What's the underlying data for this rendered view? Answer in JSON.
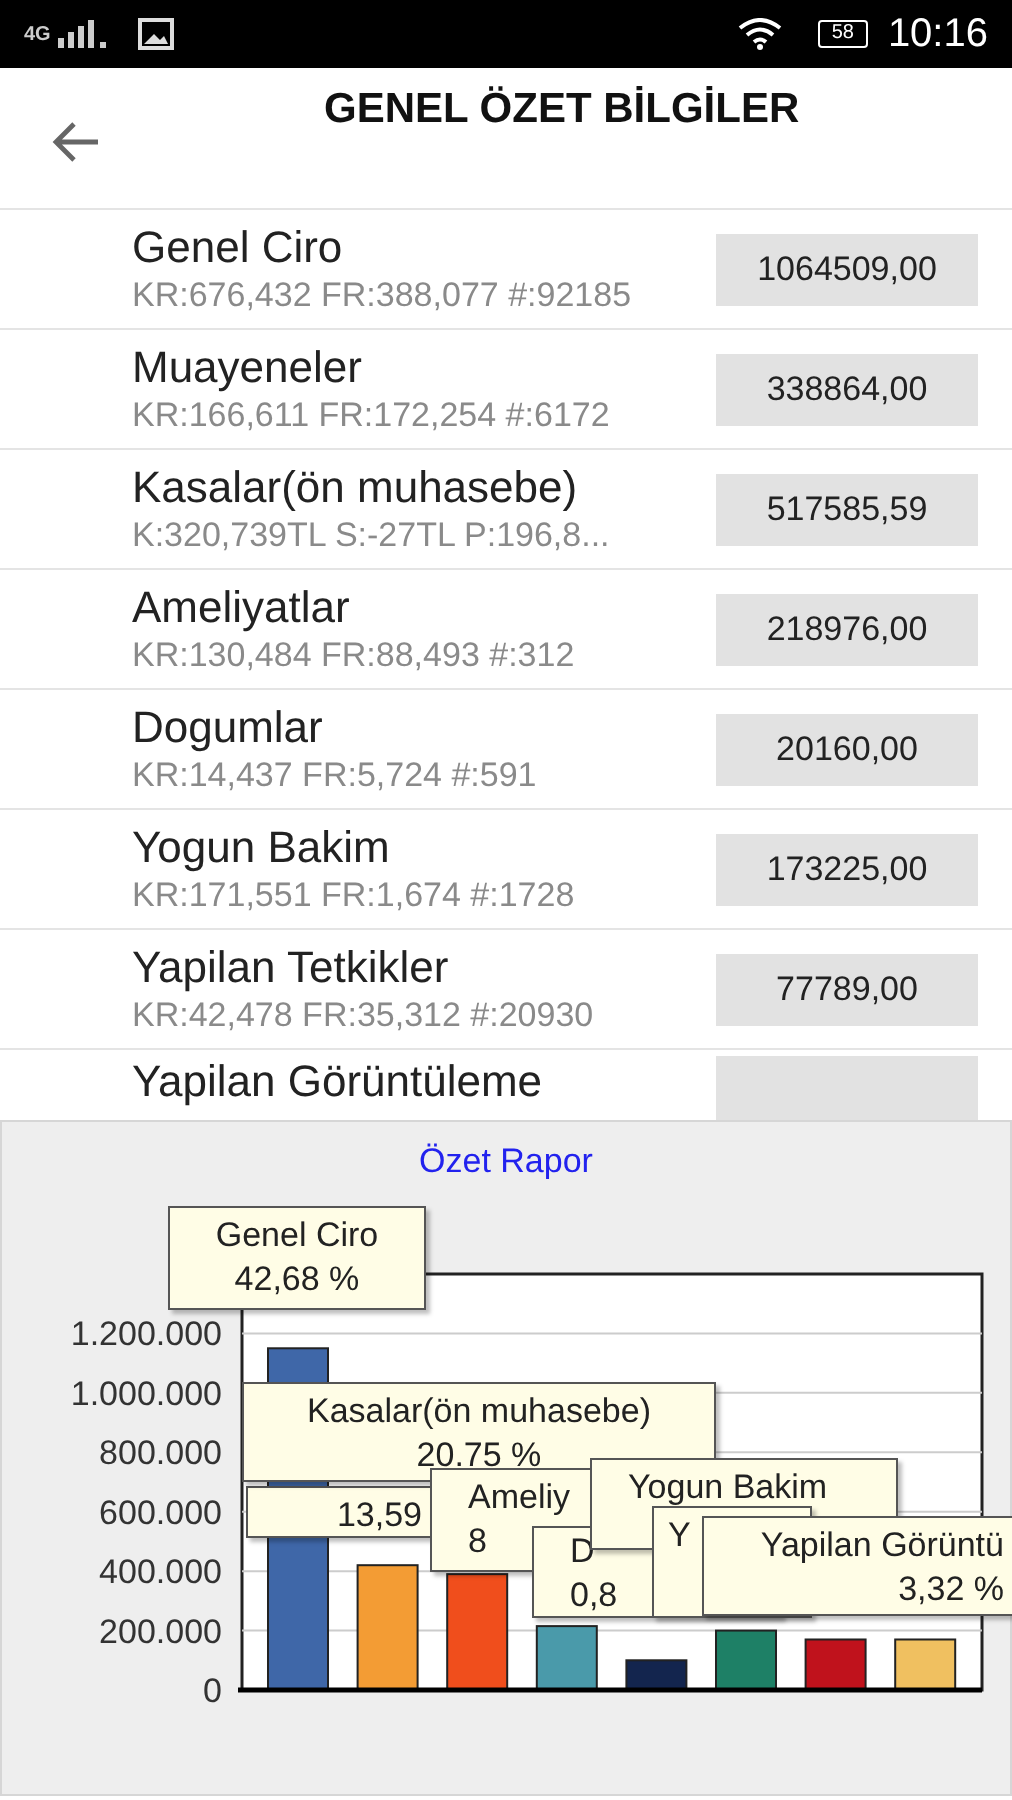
{
  "status_bar": {
    "network": "4G",
    "battery": "58",
    "time": "10:16"
  },
  "header": {
    "title": "GENEL ÖZET BİLGİLER"
  },
  "rows": [
    {
      "name": "Genel Ciro",
      "detail": "KR:676,432 FR:388,077 #:92185",
      "value": "1064509,00"
    },
    {
      "name": "Muayeneler",
      "detail": "KR:166,611 FR:172,254 #:6172",
      "value": "338864,00"
    },
    {
      "name": "Kasalar(ön muhasebe)",
      "detail": "K:320,739TL S:-27TL P:196,8...",
      "value": "517585,59"
    },
    {
      "name": "Ameliyatlar",
      "detail": "KR:130,484 FR:88,493 #:312",
      "value": "218976,00"
    },
    {
      "name": "Dogumlar",
      "detail": "KR:14,437 FR:5,724 #:591",
      "value": "20160,00"
    },
    {
      "name": "Yogun Bakim",
      "detail": "KR:171,551 FR:1,674 #:1728",
      "value": "173225,00"
    },
    {
      "name": "Yapilan Tetkikler",
      "detail": "KR:42,478 FR:35,312 #:20930",
      "value": "77789,00"
    },
    {
      "name": "Yapilan Görüntüleme"
    }
  ],
  "report": {
    "title": "Özet Rapor",
    "chart_data": {
      "type": "bar",
      "ylim": [
        0,
        1400000
      ],
      "yticks": [
        {
          "value": 0,
          "label": "0"
        },
        {
          "value": 200000,
          "label": "200.000"
        },
        {
          "value": 400000,
          "label": "400.000"
        },
        {
          "value": 600000,
          "label": "600.000"
        },
        {
          "value": 800000,
          "label": "800.000"
        },
        {
          "value": 1000000,
          "label": "1.000.000"
        },
        {
          "value": 1200000,
          "label": "1.200.000"
        }
      ],
      "grid": true,
      "values": [
        1150000,
        420000,
        390000,
        215000,
        100000,
        200000,
        170000,
        170000
      ],
      "colors": [
        "#3f67a8",
        "#f39c34",
        "#f04e1c",
        "#4a9aaa",
        "#13254e",
        "#1e8066",
        "#c0121c",
        "#f0c060"
      ],
      "annotations": [
        {
          "text": "Genel Ciro\n42,68 %"
        },
        {
          "text": "13,59"
        },
        {
          "text": "Kasalar(ön muhasebe)\n20.75 %"
        },
        {
          "text": "Ameliy\n8"
        },
        {
          "text": "D\n0,8"
        },
        {
          "text": "Yogun Bakim"
        },
        {
          "text": "Y"
        },
        {
          "text": "Yapilan Görüntü\n3,32 %"
        }
      ]
    }
  }
}
